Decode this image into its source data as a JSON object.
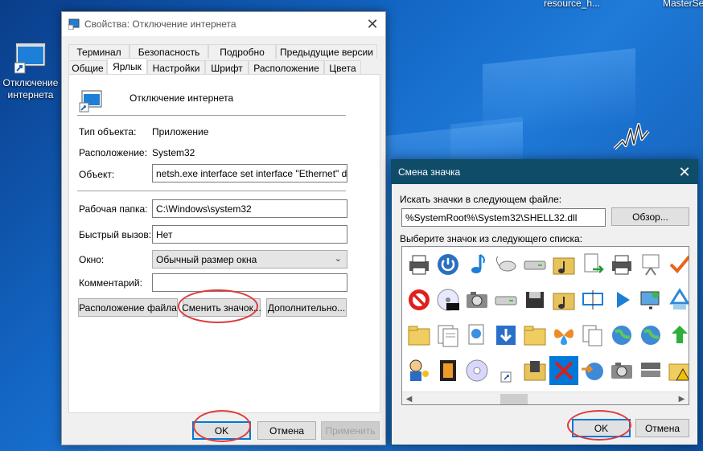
{
  "desktop": {
    "shortcut_label": "Отключение интернета",
    "top_label_1": "resource_h...",
    "top_label_2": "MasterSe"
  },
  "props_window": {
    "title": "Свойства: Отключение интернета",
    "tabs_row1": [
      "Терминал",
      "Безопасность",
      "Подробно",
      "Предыдущие версии"
    ],
    "tabs_row2": [
      "Общие",
      "Ярлык",
      "Настройки",
      "Шрифт",
      "Расположение",
      "Цвета"
    ],
    "active_tab": "Ярлык",
    "shortcut_name": "Отключение интернета",
    "type_label": "Тип объекта:",
    "type_value": "Приложение",
    "location_label": "Расположение:",
    "location_value": "System32",
    "target_label": "Объект:",
    "target_value": "netsh.exe interface set interface \"Ethernet\" disable",
    "workdir_label": "Рабочая папка:",
    "workdir_value": "C:\\Windows\\system32",
    "hotkey_label": "Быстрый вызов:",
    "hotkey_value": "Нет",
    "window_label": "Окно:",
    "window_value": "Обычный размер окна",
    "comment_label": "Комментарий:",
    "comment_value": "",
    "btn_file_location": "Расположение файла",
    "btn_change_icon": "Сменить значок...",
    "btn_advanced": "Дополнительно...",
    "btn_ok": "OK",
    "btn_cancel": "Отмена",
    "btn_apply": "Применить"
  },
  "change_icon_dialog": {
    "title": "Смена значка",
    "search_label": "Искать значки в следующем файле:",
    "file_path": "%SystemRoot%\\System32\\SHELL32.dll",
    "browse_button": "Обзор...",
    "select_label": "Выберите значок из следующего списка:",
    "icons": [
      [
        "printer-icon",
        "power-icon",
        "music-note-icon",
        "mouse-icon",
        "drive-icon",
        "music-folder-icon",
        "document-arrow-icon",
        "printer-icon",
        "projector-icon",
        "checkmark-icon"
      ],
      [
        "stop-icon",
        "dvd-icon",
        "camera-icon",
        "drive-icon",
        "floppy-icon",
        "music-folder-icon",
        "monitor-icon",
        "play-icon",
        "display-icon",
        "recycle-icon"
      ],
      [
        "folder-icon",
        "documents-icon",
        "printer-document-icon",
        "download-icon",
        "folder-icon",
        "butterfly-icon",
        "copy-icon",
        "globe-icon",
        "globe-icon",
        "refresh-icon"
      ],
      [
        "user-key-icon",
        "film-icon",
        "cd-icon",
        "shortcut-icon",
        "video-folder-icon",
        "close-icon",
        "globe-arrow-icon",
        "camera-icon",
        "server-icon",
        "warning-folder-icon"
      ]
    ],
    "selected_icon": "close-icon",
    "btn_ok": "OK",
    "btn_cancel": "Отмена"
  },
  "colors": {
    "accent": "#0078d7",
    "dialog_titlebar": "#0f4c68",
    "annotation_red": "#e03a3a"
  }
}
